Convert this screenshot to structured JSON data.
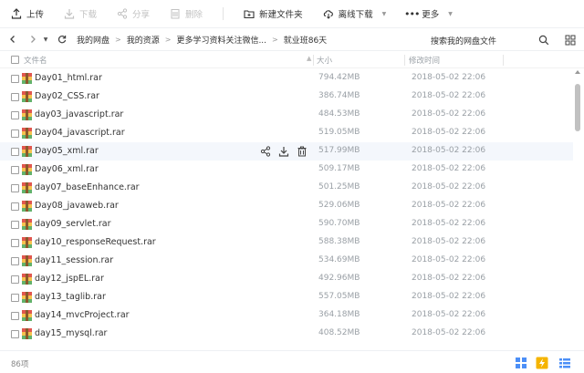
{
  "toolbar": {
    "upload": "上传",
    "download": "下载",
    "share": "分享",
    "delete": "删除",
    "new_folder": "新建文件夹",
    "offline_download": "离线下载",
    "more": "更多"
  },
  "nav": {
    "breadcrumbs": [
      "我的网盘",
      "我的资源",
      "更多学习资料关注微信...",
      "就业班86天"
    ],
    "search_placeholder": "搜索我的网盘文件"
  },
  "columns": {
    "name": "文件名",
    "size": "大小",
    "date": "修改时间"
  },
  "files": [
    {
      "name": "Day01_html.rar",
      "size": "794.42MB",
      "date": "2018-05-02 22:06"
    },
    {
      "name": "Day02_CSS.rar",
      "size": "386.74MB",
      "date": "2018-05-02 22:06"
    },
    {
      "name": "day03_javascript.rar",
      "size": "484.53MB",
      "date": "2018-05-02 22:06"
    },
    {
      "name": "Day04_javascript.rar",
      "size": "519.05MB",
      "date": "2018-05-02 22:06"
    },
    {
      "name": "Day05_xml.rar",
      "size": "517.99MB",
      "date": "2018-05-02 22:06"
    },
    {
      "name": "Day06_xml.rar",
      "size": "509.17MB",
      "date": "2018-05-02 22:06"
    },
    {
      "name": "day07_baseEnhance.rar",
      "size": "501.25MB",
      "date": "2018-05-02 22:06"
    },
    {
      "name": "Day08_javaweb.rar",
      "size": "529.06MB",
      "date": "2018-05-02 22:06"
    },
    {
      "name": "day09_servlet.rar",
      "size": "590.70MB",
      "date": "2018-05-02 22:06"
    },
    {
      "name": "day10_responseRequest.rar",
      "size": "588.38MB",
      "date": "2018-05-02 22:06"
    },
    {
      "name": "day11_session.rar",
      "size": "534.69MB",
      "date": "2018-05-02 22:06"
    },
    {
      "name": "day12_jspEL.rar",
      "size": "492.96MB",
      "date": "2018-05-02 22:06"
    },
    {
      "name": "day13_taglib.rar",
      "size": "557.05MB",
      "date": "2018-05-02 22:06"
    },
    {
      "name": "day14_mvcProject.rar",
      "size": "364.18MB",
      "date": "2018-05-02 22:06"
    },
    {
      "name": "day15_mysql.rar",
      "size": "408.52MB",
      "date": "2018-05-02 22:06"
    }
  ],
  "hovered_row": 4,
  "status": {
    "count": "86项"
  },
  "colors": {
    "accent": "#3b8cff",
    "hover_row": "#f4f7fc",
    "muted_text": "#9aa0a6"
  },
  "icons": {
    "upload": "upload-icon",
    "download": "download-icon",
    "share": "share-icon",
    "delete": "trash-icon",
    "new_folder": "folder-plus-icon",
    "offline_download": "cloud-download-icon",
    "more": "ellipsis-icon",
    "file": "rar-archive-icon"
  }
}
